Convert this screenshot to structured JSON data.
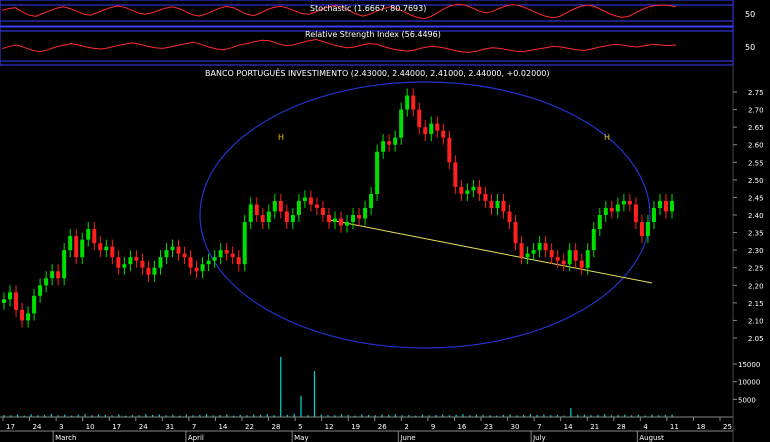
{
  "chart_data": [
    {
      "panel": "stochastic",
      "type": "line",
      "title": "Stochastic (1.6667, 80.7693)",
      "axis_labels": [
        "50"
      ],
      "colors": {
        "primary": "#ff2a2a",
        "secondary": "#ffffff",
        "frame": "#3c3cff"
      },
      "values": [
        62,
        70,
        74,
        55,
        40,
        35,
        48,
        60,
        72,
        78,
        70,
        58,
        45,
        40,
        52,
        64,
        75,
        82,
        76,
        64,
        50,
        44,
        50,
        62,
        72,
        78,
        70,
        56,
        42,
        36,
        46,
        60,
        72,
        80,
        74,
        58,
        44,
        38,
        50,
        66,
        76,
        80,
        72,
        60,
        48,
        44,
        54,
        68,
        78,
        84,
        76,
        62,
        46,
        36,
        44,
        58,
        70,
        78,
        70,
        56,
        42,
        30,
        24,
        34,
        52,
        70,
        84,
        90,
        86,
        74,
        60,
        50,
        56,
        70,
        82,
        88,
        84,
        72,
        58,
        44,
        34,
        28,
        36,
        52,
        68,
        80,
        86,
        80,
        66,
        50,
        38,
        30,
        34,
        50,
        66,
        78,
        84,
        86,
        84,
        78
      ]
    },
    {
      "panel": "rsi",
      "type": "line",
      "title": "Relative Strength Index (56.4496)",
      "axis_labels": [
        "50"
      ],
      "colors": {
        "primary": "#ff2a2a",
        "frame": "#3c3cff"
      },
      "values": [
        45,
        52,
        56,
        48,
        40,
        36,
        42,
        50,
        55,
        60,
        56,
        50,
        46,
        44,
        48,
        54,
        58,
        62,
        58,
        52,
        48,
        46,
        50,
        55,
        60,
        64,
        58,
        50,
        44,
        42,
        48,
        56,
        60,
        66,
        70,
        68,
        60,
        54,
        56,
        62,
        68,
        72,
        66,
        58,
        52,
        48,
        50,
        56,
        60,
        58,
        50,
        44,
        40,
        38,
        42,
        48,
        52,
        50,
        46,
        40,
        36,
        34,
        38,
        44,
        48,
        46,
        42,
        38,
        36,
        40,
        44,
        48,
        52,
        50,
        46,
        42,
        40,
        44,
        50,
        54,
        58,
        56,
        52,
        50,
        54,
        58,
        56,
        54,
        56
      ]
    },
    {
      "panel": "price",
      "type": "candlestick",
      "title": "BANCO PORTUGUÊS INVESTIMENTO (2.43000, 2.44000, 2.41000, 2.44000, +0.02000)",
      "y_ticks": [
        "2.75",
        "2.70",
        "2.65",
        "2.60",
        "2.55",
        "2.50",
        "2.45",
        "2.40",
        "2.35",
        "2.30",
        "2.25",
        "2.20",
        "2.15",
        "2.10",
        "2.05"
      ],
      "ylim": [
        2.0,
        2.8
      ],
      "annotations": [
        "H",
        "H"
      ],
      "colors": {
        "up": "#00e000",
        "down": "#ff2020",
        "trendline": "#e8e060",
        "ellipse": "#2233cc"
      },
      "series": [
        {
          "c": 2.16
        },
        {
          "c": 2.18
        },
        {
          "c": 2.13
        },
        {
          "c": 2.1
        },
        {
          "c": 2.12
        },
        {
          "c": 2.17
        },
        {
          "c": 2.2
        },
        {
          "c": 2.22
        },
        {
          "c": 2.24
        },
        {
          "c": 2.22
        },
        {
          "c": 2.3
        },
        {
          "c": 2.34
        },
        {
          "c": 2.28
        },
        {
          "c": 2.33
        },
        {
          "c": 2.36
        },
        {
          "c": 2.32
        },
        {
          "c": 2.3
        },
        {
          "c": 2.31
        },
        {
          "c": 2.28
        },
        {
          "c": 2.25
        },
        {
          "c": 2.26
        },
        {
          "c": 2.28
        },
        {
          "c": 2.27
        },
        {
          "c": 2.25
        },
        {
          "c": 2.23
        },
        {
          "c": 2.25
        },
        {
          "c": 2.28
        },
        {
          "c": 2.3
        },
        {
          "c": 2.31
        },
        {
          "c": 2.29
        },
        {
          "c": 2.28
        },
        {
          "c": 2.25
        },
        {
          "c": 2.24
        },
        {
          "c": 2.26
        },
        {
          "c": 2.27
        },
        {
          "c": 2.28
        },
        {
          "c": 2.3
        },
        {
          "c": 2.29
        },
        {
          "c": 2.28
        },
        {
          "c": 2.26
        },
        {
          "c": 2.38
        },
        {
          "c": 2.43
        },
        {
          "c": 2.4
        },
        {
          "c": 2.38
        },
        {
          "c": 2.41
        },
        {
          "c": 2.44
        },
        {
          "c": 2.41
        },
        {
          "c": 2.38
        },
        {
          "c": 2.4
        },
        {
          "c": 2.44
        },
        {
          "c": 2.45
        },
        {
          "c": 2.43
        },
        {
          "c": 2.42
        },
        {
          "c": 2.4
        },
        {
          "c": 2.38
        },
        {
          "c": 2.39
        },
        {
          "c": 2.37
        },
        {
          "c": 2.38
        },
        {
          "c": 2.4
        },
        {
          "c": 2.39
        },
        {
          "c": 2.42
        },
        {
          "c": 2.46
        },
        {
          "c": 2.58
        },
        {
          "c": 2.61
        },
        {
          "c": 2.6
        },
        {
          "c": 2.62
        },
        {
          "c": 2.7
        },
        {
          "c": 2.74
        },
        {
          "c": 2.7
        },
        {
          "c": 2.65
        },
        {
          "c": 2.63
        },
        {
          "c": 2.66
        },
        {
          "c": 2.64
        },
        {
          "c": 2.62
        },
        {
          "c": 2.55
        },
        {
          "c": 2.48
        },
        {
          "c": 2.46
        },
        {
          "c": 2.47
        },
        {
          "c": 2.48
        },
        {
          "c": 2.46
        },
        {
          "c": 2.44
        },
        {
          "c": 2.42
        },
        {
          "c": 2.44
        },
        {
          "c": 2.41
        },
        {
          "c": 2.38
        },
        {
          "c": 2.32
        },
        {
          "c": 2.28
        },
        {
          "c": 2.29
        },
        {
          "c": 2.3
        },
        {
          "c": 2.32
        },
        {
          "c": 2.3
        },
        {
          "c": 2.28
        },
        {
          "c": 2.27
        },
        {
          "c": 2.26
        },
        {
          "c": 2.3
        },
        {
          "c": 2.27
        },
        {
          "c": 2.25
        },
        {
          "c": 2.3
        },
        {
          "c": 2.36
        },
        {
          "c": 2.4
        },
        {
          "c": 2.42
        },
        {
          "c": 2.41
        },
        {
          "c": 2.43
        },
        {
          "c": 2.44
        },
        {
          "c": 2.43
        },
        {
          "c": 2.38
        },
        {
          "c": 2.34
        },
        {
          "c": 2.38
        },
        {
          "c": 2.42
        },
        {
          "c": 2.44
        },
        {
          "c": 2.41
        },
        {
          "c": 2.44
        }
      ]
    },
    {
      "panel": "volume",
      "type": "bar",
      "y_ticks": [
        "15000",
        "10000",
        "5000"
      ],
      "colors": {
        "bar": "#00d8d8"
      },
      "values": [
        600,
        500,
        700,
        400,
        800,
        500,
        600,
        900,
        500,
        700,
        400,
        600,
        800,
        500,
        700,
        600,
        500,
        700,
        400,
        600,
        500,
        800,
        600,
        700,
        500,
        600,
        400,
        700,
        500,
        600,
        800,
        500,
        600,
        700,
        400,
        600,
        500,
        700,
        600,
        800,
        500,
        17000,
        600,
        900,
        6000,
        500,
        13000,
        700,
        600,
        500,
        800,
        600,
        400,
        700,
        600,
        500,
        700,
        600,
        800,
        500,
        600,
        400,
        700,
        500,
        600,
        700,
        500,
        600,
        800,
        500,
        700,
        600,
        500,
        400,
        600,
        700,
        500,
        600,
        800,
        600,
        700,
        500,
        600,
        400,
        2500,
        600,
        700,
        500,
        600,
        800,
        500,
        600,
        700,
        500,
        600,
        400,
        700,
        500,
        600,
        700
      ]
    }
  ],
  "x_axis": {
    "day_ticks": [
      "17",
      "24",
      "3",
      "10",
      "17",
      "24",
      "31",
      "7",
      "14",
      "22",
      "28",
      "5",
      "12",
      "19",
      "26",
      "2",
      "9",
      "16",
      "23",
      "30",
      "7",
      "14",
      "21",
      "28",
      "4",
      "11",
      "18",
      "25"
    ],
    "month_labels": [
      "March",
      "April",
      "May",
      "June",
      "July",
      "August"
    ]
  }
}
